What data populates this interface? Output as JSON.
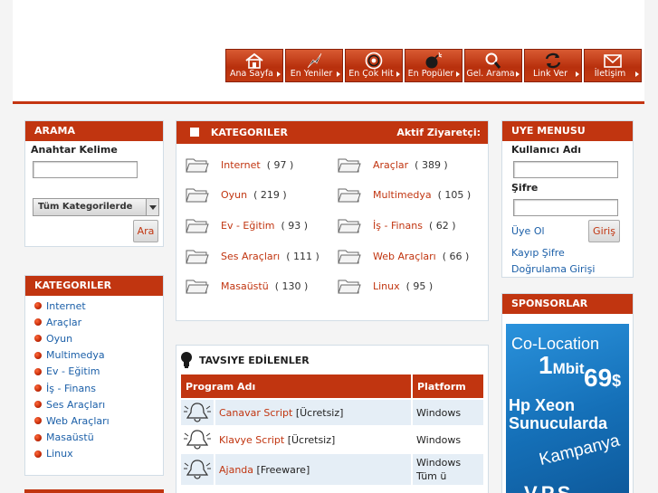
{
  "nav": [
    {
      "label": "Ana Sayfa",
      "icon": "home-icon"
    },
    {
      "label": "En Yeniler",
      "icon": "lightning-icon"
    },
    {
      "label": "En Çok Hit",
      "icon": "target-icon"
    },
    {
      "label": "En Popüler",
      "icon": "bomb-icon"
    },
    {
      "label": "Gel. Arama",
      "icon": "magnifier-icon"
    },
    {
      "label": "Link Ver",
      "icon": "link-arrows-icon"
    },
    {
      "label": "İletişim",
      "icon": "envelope-icon"
    }
  ],
  "search": {
    "title": "ARAMA",
    "keyword_label": "Anahtar Kelime",
    "keyword_value": "",
    "category_selected": "Tüm Kategorilerde",
    "button": "Ara"
  },
  "sidebar_categories": {
    "title": "KATEGORILER",
    "items": [
      "Internet",
      "Araçlar",
      "Oyun",
      "Multimedya",
      "Ev - Eğitim",
      "İş - Finans",
      "Ses Araçları",
      "Web Araçları",
      "Masaüstü",
      "Linux"
    ]
  },
  "categories": {
    "title": "KATEGORILER",
    "active_visitors": "Aktif Ziyaretçi:",
    "left": [
      {
        "name": "Internet",
        "count": "( 97 )"
      },
      {
        "name": "Oyun",
        "count": "( 219 )"
      },
      {
        "name": "Ev - Eğitim",
        "count": "( 93 )"
      },
      {
        "name": "Ses Araçları",
        "count": "( 111 )"
      },
      {
        "name": "Masaüstü",
        "count": "( 130 )"
      }
    ],
    "right": [
      {
        "name": "Araçlar",
        "count": "( 389 )"
      },
      {
        "name": "Multimedya",
        "count": "( 105 )"
      },
      {
        "name": "İş - Finans",
        "count": "( 62 )"
      },
      {
        "name": "Web Araçları",
        "count": "( 66 )"
      },
      {
        "name": "Linux",
        "count": "( 95 )"
      }
    ]
  },
  "recommended": {
    "title": "TAVSIYE EDİLENLER",
    "col_program": "Program Adı",
    "col_platform": "Platform",
    "rows": [
      {
        "name": "Canavar Script",
        "license": "[Ücretsiz]",
        "platform": "Windows"
      },
      {
        "name": "Klavye Script",
        "license": "[Ücretsiz]",
        "platform": "Windows"
      },
      {
        "name": "Ajanda",
        "license": "[Freeware]",
        "platform": "Windows Tüm ü"
      }
    ]
  },
  "user_menu": {
    "title": "UYE MENUSU",
    "username_label": "Kullanıcı Adı",
    "password_label": "Şifre",
    "register": "Üye Ol",
    "login_button": "Giriş",
    "forgot": "Kayıp Şifre",
    "verify": "Doğrulama Girişi"
  },
  "sponsors": {
    "title": "SPONSORLAR",
    "ad_line1": "Co-Location",
    "ad_mbit_num": "1",
    "ad_mbit_unit": "Mbit",
    "ad_price": "69",
    "ad_currency": "$",
    "ad_line3": "Hp Xeon",
    "ad_line4": "Sunucularda",
    "ad_line5": "Kampanya",
    "ad_line6": "V.P.S"
  },
  "colors": {
    "accent": "#c13510",
    "link": "#1b5fa8",
    "border": "#d2dde6",
    "ad_blue": "#1a7cc8"
  }
}
